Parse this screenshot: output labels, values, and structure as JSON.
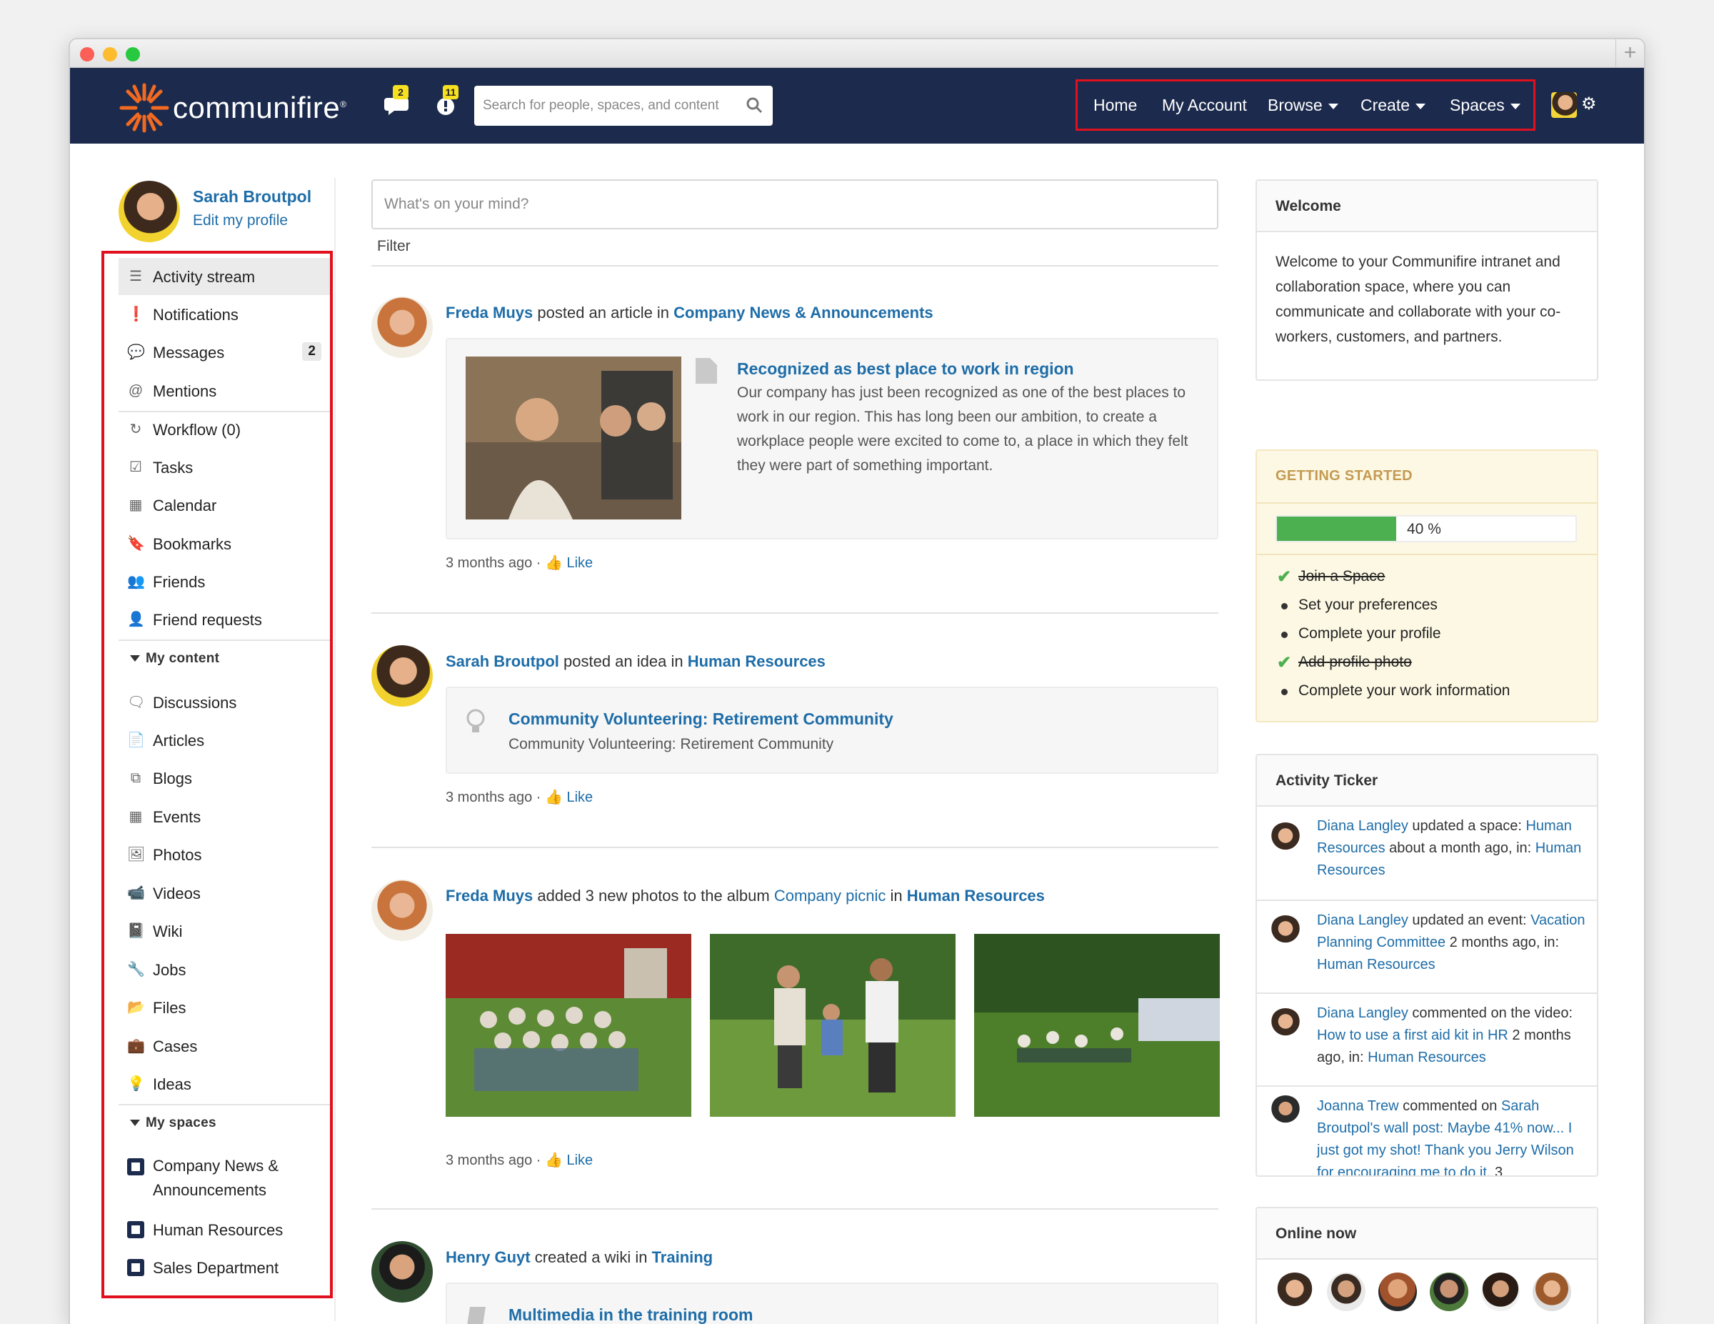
{
  "window": {
    "new_tab": "+"
  },
  "header": {
    "logo_text": "communifire",
    "logo_mark": "®",
    "chat_badge": "2",
    "alerts_badge": "11",
    "search_placeholder": "Search for people, spaces, and content",
    "menu": {
      "home": "Home",
      "my_account": "My Account",
      "browse": "Browse",
      "create": "Create",
      "spaces": "Spaces"
    },
    "accent": "#1c2b4d"
  },
  "profile": {
    "name": "Sarah Broutpol",
    "edit": "Edit my profile"
  },
  "sidebar": {
    "activity_stream": "Activity stream",
    "notifications": "Notifications",
    "messages": "Messages",
    "messages_count": "2",
    "mentions": "Mentions",
    "workflow": "Workflow (0)",
    "tasks": "Tasks",
    "calendar": "Calendar",
    "bookmarks": "Bookmarks",
    "friends": "Friends",
    "friend_requests": "Friend requests",
    "my_content": "My content",
    "discussions": "Discussions",
    "articles": "Articles",
    "blogs": "Blogs",
    "events": "Events",
    "photos": "Photos",
    "videos": "Videos",
    "wiki": "Wiki",
    "jobs": "Jobs",
    "files": "Files",
    "cases": "Cases",
    "ideas": "Ideas",
    "my_spaces": "My spaces",
    "space_company_1": "Company News &",
    "space_company_2": "Announcements",
    "space_hr": "Human Resources",
    "space_sales": "Sales Department"
  },
  "feed": {
    "composer_placeholder": "What's on your mind?",
    "filter": "Filter",
    "like": "Like",
    "dot": "·",
    "posts": [
      {
        "who": "Freda Muys",
        "verb": " posted an article in ",
        "where": "Company News & Announcements",
        "title": "Recognized as best place to work in region",
        "excerpt": "Our company has just been recognized as one of the best places to work in our region. This has long been our ambition, to create a workplace people were excited to come to, a place in which they felt they were part of something important.",
        "time": "3 months ago"
      },
      {
        "who": "Sarah Broutpol",
        "verb": " posted an idea in ",
        "where": "Human Resources",
        "title": "Community Volunteering: Retirement Community",
        "excerpt": "Community Volunteering: Retirement Community",
        "time": "3 months ago"
      },
      {
        "who": "Freda Muys",
        "verb": " added 3 new photos to the album ",
        "album": "Company picnic",
        "in": " in ",
        "where": "Human Resources",
        "time": "3 months ago"
      },
      {
        "who": "Henry Guyt",
        "verb": " created a wiki in ",
        "where": "Training",
        "title": "Multimedia in the training room"
      }
    ]
  },
  "welcome": {
    "title": "Welcome",
    "text": "Welcome to your Communifire intranet and collaboration space, where you can communicate and collaborate with your co-workers, customers, and partners."
  },
  "getting_started": {
    "title": "GETTING STARTED",
    "progress": 40,
    "progress_label": "40 %",
    "items": [
      {
        "label": "Join a Space",
        "done": true
      },
      {
        "label": "Set your preferences",
        "done": false
      },
      {
        "label": "Complete your profile",
        "done": false
      },
      {
        "label": "Add profile photo",
        "done": true
      },
      {
        "label": "Complete your work information",
        "done": false
      }
    ],
    "bar_color": "#4caf50"
  },
  "ticker": {
    "title": "Activity Ticker",
    "i1": {
      "who": "Diana Langley",
      "a": " updated a space: ",
      "obj": "Human Resources",
      "b": " about a month ago, in: ",
      "where": "Human Resources"
    },
    "i2": {
      "who": "Diana Langley",
      "a": " updated an event: ",
      "obj": "Vacation Planning Committee",
      "b": " 2 months ago, in: ",
      "where": "Human Resources"
    },
    "i3": {
      "who": "Diana Langley",
      "a": " commented on the video: ",
      "obj": "How to use a first aid kit in HR",
      "b": " 2 months ago, in: ",
      "where": "Human Resources"
    },
    "i4": {
      "who": "Joanna Trew",
      "a": " commented on ",
      "obj": "Sarah Broutpol's wall post: Maybe 41% now... I just got my shot! Thank you Jerry Wilson for encouraging me to do it.",
      "b": " 3"
    }
  },
  "online": {
    "title": "Online now"
  }
}
